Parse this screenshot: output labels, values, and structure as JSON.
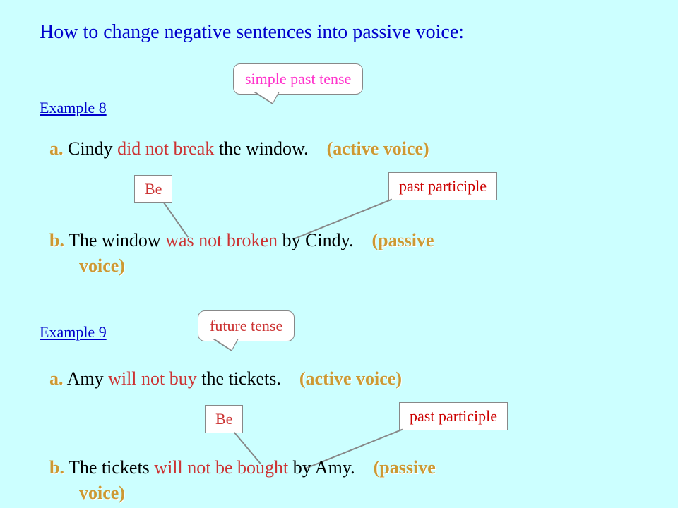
{
  "title": "How to change negative sentences into passive voice:",
  "ex8": {
    "label": "Example 8",
    "tense_callout": "simple past tense",
    "a": {
      "letter": "a.",
      "p1": "Cindy ",
      "p2": "did not break",
      "p3": " the window.",
      "tag": "(active voice)"
    },
    "be_label": "Be",
    "pp_label": "past participle",
    "b": {
      "letter": "b.",
      "p1": "The window ",
      "p2": "was not broken",
      "p3": " by Cindy.",
      "tag": "(passive",
      "tag2": "voice)"
    }
  },
  "ex9": {
    "label": "Example 9",
    "tense_callout": "future tense",
    "a": {
      "letter": "a.",
      "p1": "Amy ",
      "p2": "will not buy",
      "p3": " the tickets.",
      "tag": "(active voice)"
    },
    "be_label": "Be",
    "pp_label": "past participle",
    "b": {
      "letter": "b.",
      "p1": "The tickets ",
      "p2": "will not be bought",
      "p3": " by Amy.",
      "tag": "(passive",
      "tag2": "voice)"
    }
  }
}
